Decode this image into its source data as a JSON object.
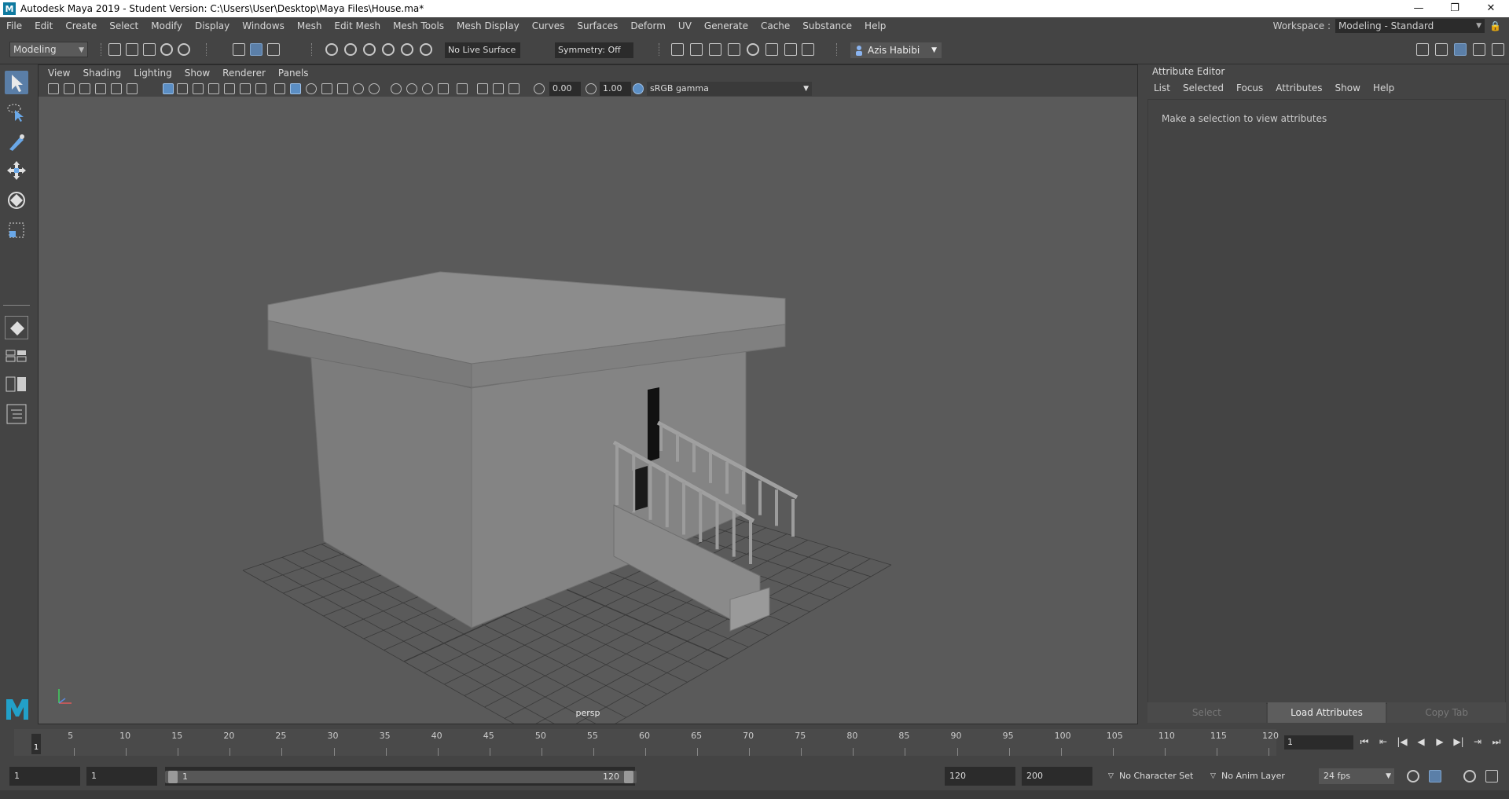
{
  "window": {
    "title": "Autodesk Maya 2019 - Student Version: C:\\Users\\User\\Desktop\\Maya Files\\House.ma*",
    "logo_letter": "M",
    "minimize": "—",
    "restore": "❐",
    "close": "✕"
  },
  "menubar": {
    "items": [
      "File",
      "Edit",
      "Create",
      "Select",
      "Modify",
      "Display",
      "Windows",
      "Mesh",
      "Edit Mesh",
      "Mesh Tools",
      "Mesh Display",
      "Curves",
      "Surfaces",
      "Deform",
      "UV",
      "Generate",
      "Cache",
      "Substance",
      "Help"
    ],
    "workspace_label": "Workspace :",
    "workspace_value": "Modeling - Standard"
  },
  "statusline": {
    "mode": "Modeling",
    "live_surface": "No Live Surface",
    "symmetry": "Symmetry: Off",
    "user": "Azis Habibi"
  },
  "viewport": {
    "menu": [
      "View",
      "Shading",
      "Lighting",
      "Show",
      "Renderer",
      "Panels"
    ],
    "exposure": "0.00",
    "gamma": "1.00",
    "color_space": "sRGB gamma",
    "camera": "persp",
    "colors": {
      "background": "#5a5a5a",
      "grid": "#3a3a3a",
      "mesh": "#8a8a8a"
    }
  },
  "attribute_editor": {
    "title": "Attribute Editor",
    "menu": [
      "List",
      "Selected",
      "Focus",
      "Attributes",
      "Show",
      "Help"
    ],
    "message": "Make a selection to view attributes",
    "buttons": {
      "select": "Select",
      "load": "Load Attributes",
      "copy": "Copy Tab"
    }
  },
  "timeslider": {
    "ticks": [
      "5",
      "10",
      "15",
      "20",
      "25",
      "30",
      "35",
      "40",
      "45",
      "50",
      "55",
      "60",
      "65",
      "70",
      "75",
      "80",
      "85",
      "90",
      "95",
      "100",
      "105",
      "110",
      "115",
      "120"
    ],
    "current_frame": "1",
    "frame_field": "1"
  },
  "rangeslider": {
    "start": "1",
    "playback_start": "1",
    "range_start": "1",
    "range_end": "120",
    "playback_end": "120",
    "end": "200",
    "character_set": "No Character Set",
    "anim_layer": "No Anim Layer",
    "fps": "24 fps"
  }
}
